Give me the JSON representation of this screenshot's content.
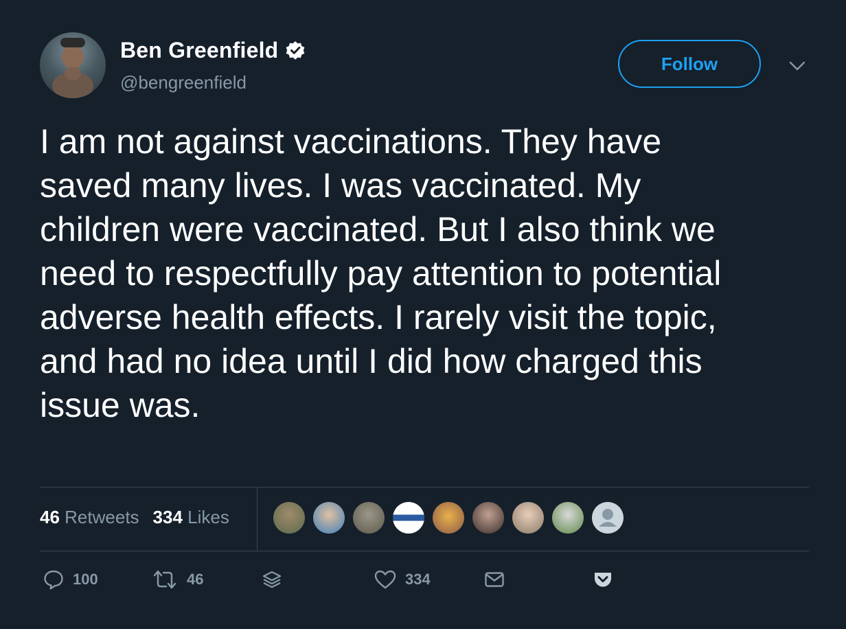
{
  "author": {
    "name": "Ben Greenfield",
    "handle": "@bengreenfield",
    "verified": true
  },
  "follow_label": "Follow",
  "tweet": {
    "text": "I am not against vaccinations. They have\nsaved many lives. I was vaccinated. My\nchildren were vaccinated. But I also think we\nneed to respectfully pay attention to potential\nadverse health effects. I rarely visit the topic,\nand had no idea until I did how charged this\nissue was."
  },
  "stats": {
    "retweets_count": "46",
    "retweets_label": "Retweets",
    "likes_count": "334",
    "likes_label": "Likes"
  },
  "liker_avatars": [
    {
      "color": "#5b6a4e"
    },
    {
      "color": "#3f7fb8"
    },
    {
      "color": "#7d7a6a"
    },
    {
      "color": "#dfe6ef"
    },
    {
      "color": "#8a5a4a"
    },
    {
      "color": "#6b5a55"
    },
    {
      "color": "#c9b8a8"
    },
    {
      "color": "#7fa06a"
    },
    {
      "color": "#ccd6dd"
    }
  ],
  "actions": {
    "reply_count": "100",
    "retweet_count": "46",
    "like_count": "334"
  },
  "colors": {
    "background": "#15202b",
    "accent": "#1da1f2",
    "secondary_text": "#8899a6"
  }
}
